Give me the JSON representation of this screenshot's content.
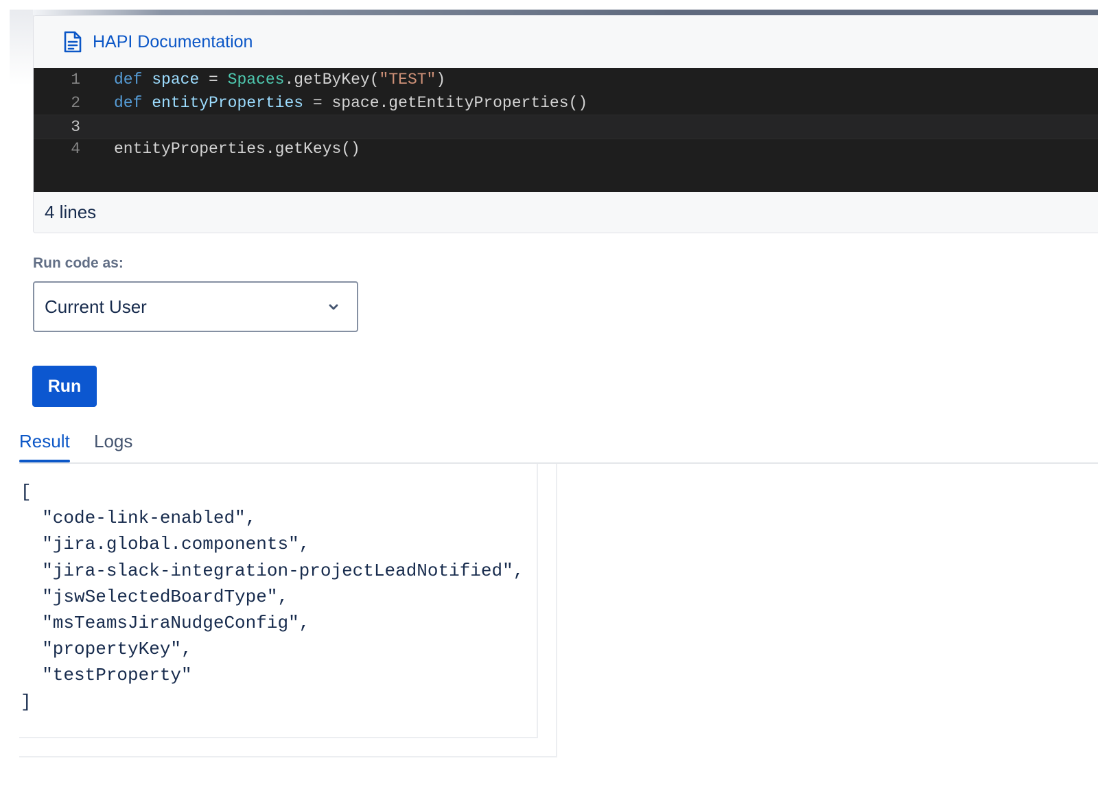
{
  "header": {
    "doc_link_label": "HAPI Documentation",
    "doc_icon": "document-icon"
  },
  "editor": {
    "lines": [
      {
        "number": "1",
        "tokens": [
          {
            "text": "def",
            "type": "kw"
          },
          {
            "text": " ",
            "type": "plain"
          },
          {
            "text": "space",
            "type": "var"
          },
          {
            "text": " = ",
            "type": "plain"
          },
          {
            "text": "Spaces",
            "type": "cls"
          },
          {
            "text": ".getByKey(",
            "type": "plain"
          },
          {
            "text": "\"TEST\"",
            "type": "str"
          },
          {
            "text": ")",
            "type": "plain"
          }
        ]
      },
      {
        "number": "2",
        "tokens": [
          {
            "text": "def",
            "type": "kw"
          },
          {
            "text": " ",
            "type": "plain"
          },
          {
            "text": "entityProperties",
            "type": "var"
          },
          {
            "text": " = space.getEntityProperties()",
            "type": "plain"
          }
        ]
      },
      {
        "number": "3",
        "tokens": [],
        "active": true
      },
      {
        "number": "4",
        "tokens": [
          {
            "text": "entityProperties.getKeys()",
            "type": "plain"
          }
        ]
      }
    ],
    "line_count_label": "4 lines",
    "colors": {
      "background": "#1e1e1e",
      "keyword": "#569cd6",
      "variable": "#9cdcfe",
      "class": "#4ec9b0",
      "string": "#ce9178"
    }
  },
  "run_as": {
    "label": "Run code as:",
    "selected_value": "Current User",
    "chevron_icon": "chevron-down-icon"
  },
  "run_button": {
    "label": "Run",
    "color": "#0c57d0"
  },
  "tabs": {
    "result_label": "Result",
    "logs_label": "Logs",
    "active": "Result",
    "accent": "#0c57c7"
  },
  "result": {
    "output": "[\n  \"code-link-enabled\",\n  \"jira.global.components\",\n  \"jira-slack-integration-projectLeadNotified\",\n  \"jswSelectedBoardType\",\n  \"msTeamsJiraNudgeConfig\",\n  \"propertyKey\",\n  \"testProperty\"\n]"
  }
}
